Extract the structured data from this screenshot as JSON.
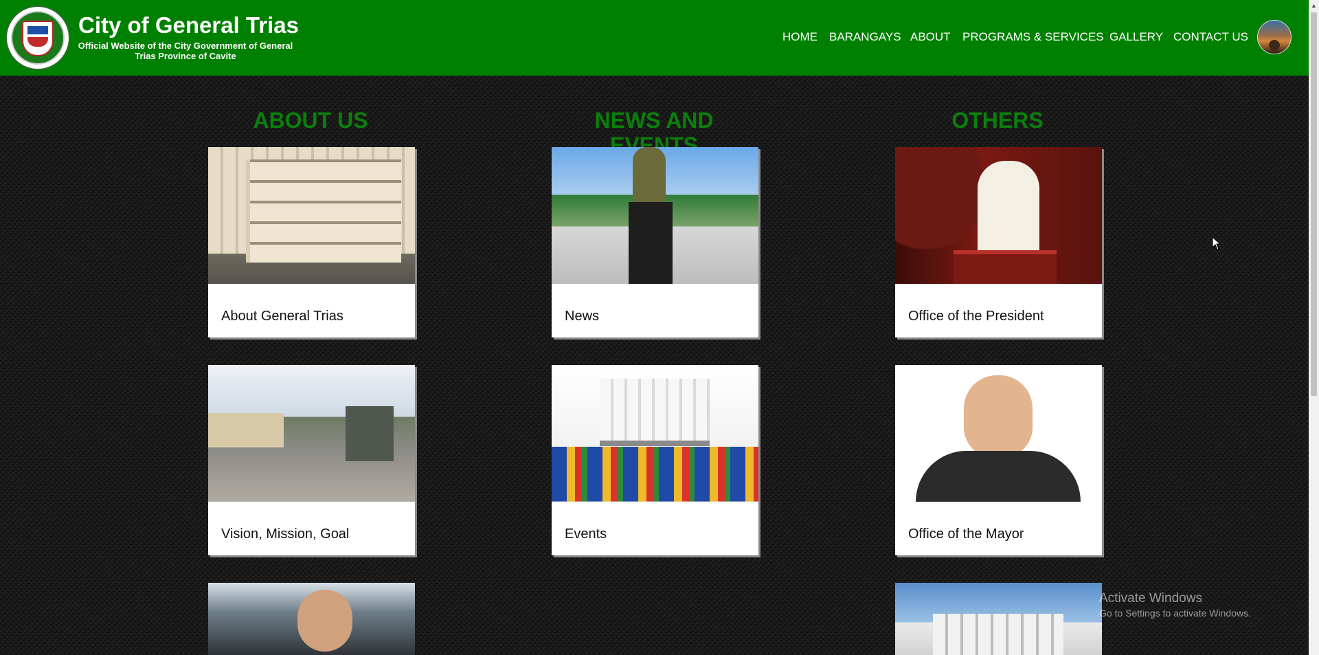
{
  "header": {
    "title": "City of General Trias",
    "subtitle": "Official Website of the City Government of General Trias Province of Cavite",
    "logo_alt": "Seal of the City of General Trias"
  },
  "nav": {
    "items": [
      {
        "label": "HOME"
      },
      {
        "label": "BARANGAYS"
      },
      {
        "label": "ABOUT"
      },
      {
        "label": "PROGRAMS & SERVICES"
      },
      {
        "label": "GALLERY"
      },
      {
        "label": "CONTACT US"
      }
    ]
  },
  "sections": [
    {
      "title": "ABOUT US",
      "cards": [
        {
          "label": "About General Trias"
        },
        {
          "label": "Vision, Mission, Goal"
        },
        {
          "label": ""
        }
      ]
    },
    {
      "title": "NEWS AND EVENTS",
      "cards": [
        {
          "label": "News"
        },
        {
          "label": "Events"
        }
      ]
    },
    {
      "title": "OTHERS",
      "cards": [
        {
          "label": "Office of the President"
        },
        {
          "label": "Office of the Mayor"
        },
        {
          "label": ""
        }
      ]
    }
  ],
  "watermark": {
    "line1": "Activate Windows",
    "line2": "Go to Settings to activate Windows."
  },
  "icons": {
    "scroll_up": "scroll-up-arrow-icon",
    "cursor": "mouse-pointer-icon"
  }
}
